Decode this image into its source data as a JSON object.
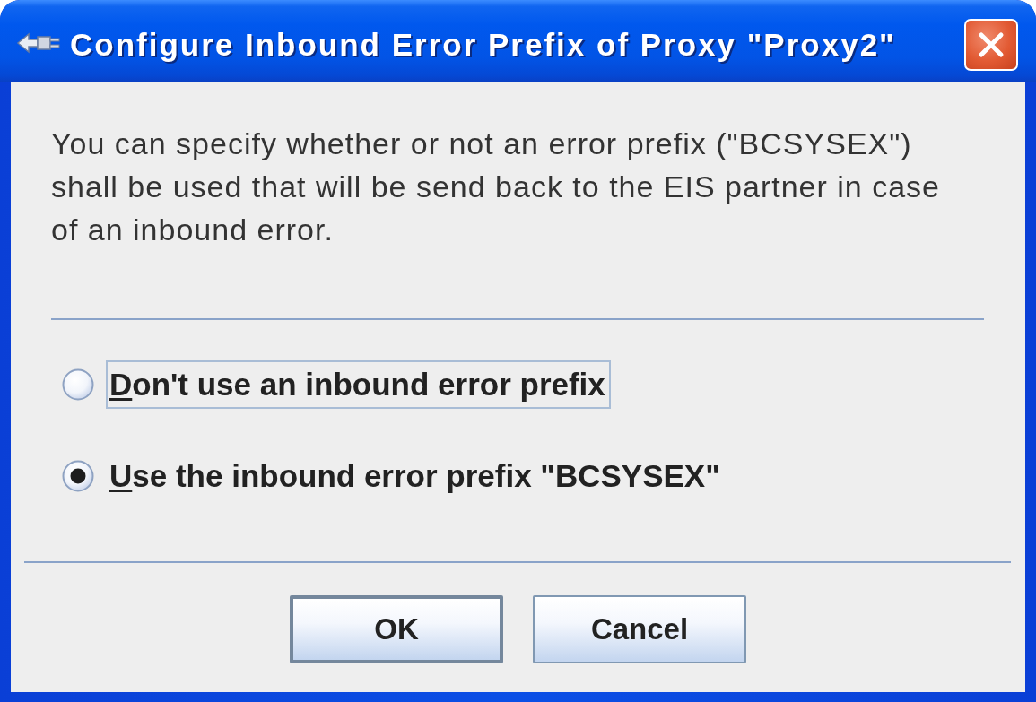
{
  "window": {
    "title": "Configure Inbound Error Prefix of Proxy \"Proxy2\""
  },
  "description": "You can specify whether or not an error prefix (\"BCSYSEX\") shall be used that will be send back to the EIS partner in case of an inbound error.",
  "options": [
    {
      "label": "Don't use an inbound error prefix",
      "selected": false,
      "focused": true,
      "mnemonic_underlined": true
    },
    {
      "label": "Use the inbound error prefix \"BCSYSEX\"",
      "selected": true,
      "focused": false,
      "mnemonic_underlined": true
    }
  ],
  "buttons": [
    {
      "label": "OK",
      "default": true
    },
    {
      "label": "Cancel",
      "default": false
    }
  ]
}
